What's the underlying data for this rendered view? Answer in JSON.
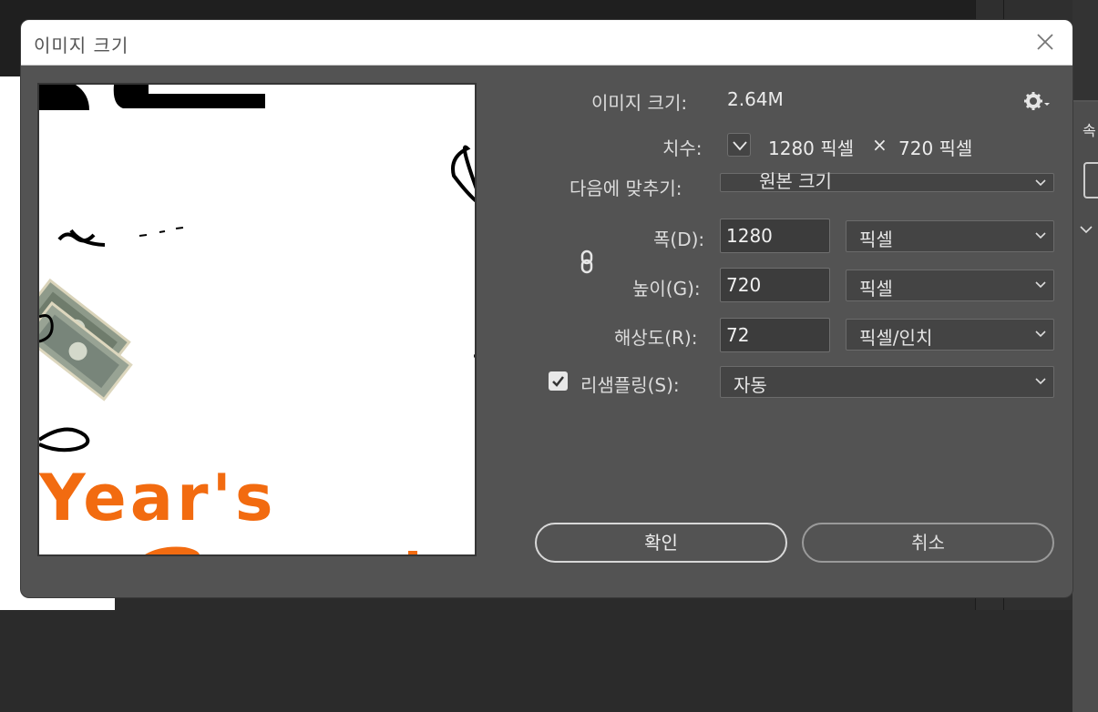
{
  "dialog": {
    "title": "이미지 크기",
    "close_icon": "close-icon"
  },
  "info": {
    "image_size_label": "이미지 크기:",
    "image_size_value": "2.64M",
    "settings_icon": "gear-icon",
    "dimensions_label": "치수:",
    "dimensions_width": "1280 픽셀",
    "dimensions_times": "×",
    "dimensions_height": "720 픽셀"
  },
  "fit_to": {
    "label": "다음에 맞추기:",
    "value": "원본 크기"
  },
  "width": {
    "label": "폭(D):",
    "value": "1280",
    "unit": "픽셀"
  },
  "height": {
    "label": "높이(G):",
    "value": "720",
    "unit": "픽셀"
  },
  "resolution": {
    "label": "해상도(R):",
    "value": "72",
    "unit": "픽셀/인치"
  },
  "resample": {
    "label": "리샘플링(S):",
    "checked": true,
    "value": "자동"
  },
  "buttons": {
    "ok": "확인",
    "cancel": "취소"
  },
  "preview": {
    "text": "Year's"
  },
  "background": {
    "panel_label": "속"
  },
  "colors": {
    "dialog_bg": "#535353",
    "accent_orange": "#f26b10"
  }
}
